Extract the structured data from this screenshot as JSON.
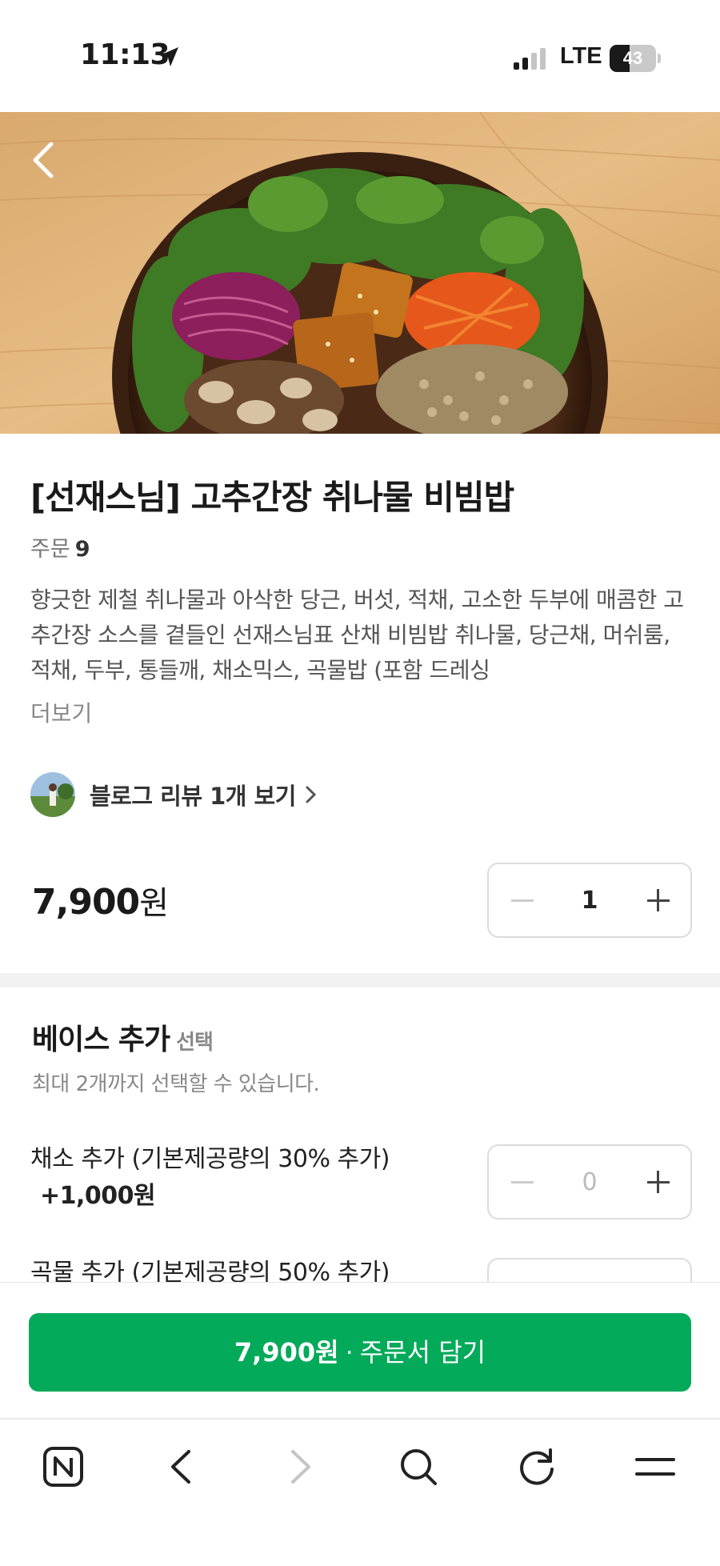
{
  "status_bar": {
    "time": "11:13",
    "network": "LTE",
    "battery_level": "43",
    "battery_fraction": 0.43
  },
  "product": {
    "title": "[선재스님] 고추간장 취나물 비빔밥",
    "order_label": "주문",
    "order_count": "9",
    "description": "향긋한 제철 취나물과 아삭한 당근, 버섯, 적채, 고소한 두부에 매콤한 고추간장 소스를 곁들인 선재스님표 산채 비빔밥 취나물, 당근채, 머쉬룸, 적채, 두부, 통들깨, 채소믹스, 곡물밥 (포함 드레싱",
    "more_label": "더보기",
    "review_link": "블로그 리뷰 1개 보기",
    "price_number": "7,900",
    "price_unit": "원",
    "quantity": "1"
  },
  "options_section": {
    "title": "베이스 추가",
    "optional_tag": "선택",
    "subtitle": "최대 2개까지 선택할 수 있습니다.",
    "items": [
      {
        "name": "채소 추가 (기본제공량의 30% 추가)",
        "price": "+1,000원",
        "quantity": "0"
      },
      {
        "name": "곡물 추가 (기본제공량의 50% 추가)"
      }
    ]
  },
  "order_button": {
    "amount": "7,900원",
    "separator": "·",
    "label": "주문서 담기"
  },
  "colors": {
    "accent_green": "#03aa5a",
    "text_primary": "#1a1a1a",
    "text_secondary": "#888888"
  },
  "toolbar_icons": [
    "naver-n-icon",
    "back-icon",
    "forward-icon",
    "search-icon",
    "refresh-icon",
    "menu-icon"
  ]
}
